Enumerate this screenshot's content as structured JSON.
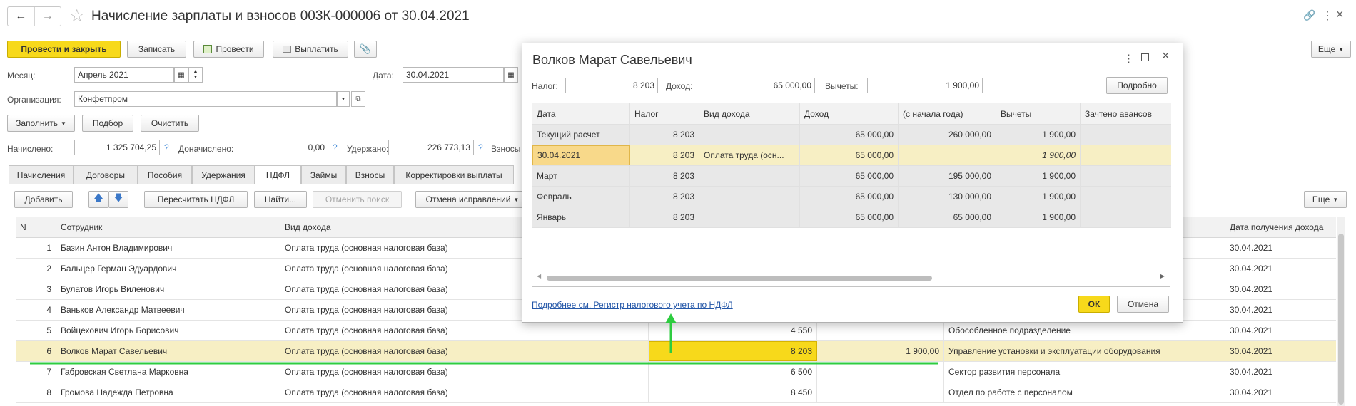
{
  "window": {
    "title": "Начисление зарплаты и взносов 003К-000006 от 30.04.2021"
  },
  "toolbar": {
    "post_close": "Провести и закрыть",
    "save": "Записать",
    "post": "Провести",
    "pay": "Выплатить",
    "more": "Еще"
  },
  "header": {
    "month_label": "Месяц:",
    "month_value": "Апрель 2021",
    "date_label": "Дата:",
    "date_value": "30.04.2021",
    "org_label": "Организация:",
    "org_value": "Конфетпром",
    "fill": "Заполнить",
    "select": "Подбор",
    "clear": "Очистить",
    "accrued_label": "Начислено:",
    "accrued_value": "1 325 704,25",
    "additional_label": "Доначислено:",
    "additional_value": "0,00",
    "withheld_label": "Удержано:",
    "withheld_value": "226 773,13",
    "contrib_label": "Взносы",
    "help": "?"
  },
  "tabs": [
    "Начисления",
    "Договоры",
    "Пособия",
    "Удержания",
    "НДФЛ",
    "Займы",
    "Взносы",
    "Корректировки выплаты"
  ],
  "table_toolbar": {
    "add": "Добавить",
    "recalc": "Пересчитать НДФЛ",
    "find": "Найти...",
    "cancel_search": "Отменить поиск",
    "cancel_fix": "Отмена исправлений",
    "more": "Еще"
  },
  "table": {
    "headers": {
      "n": "N",
      "employee": "Сотрудник",
      "income_type": "Вид дохода",
      "receive_date": "Дата получения дохода"
    },
    "rows": [
      {
        "n": "1",
        "employee": "Базин Антон Владимирович",
        "income": "Оплата труда (основная налоговая база)",
        "tax": "",
        "deduct": "",
        "dept": "",
        "date": "30.04.2021"
      },
      {
        "n": "2",
        "employee": "Бальцер Герман Эдуардович",
        "income": "Оплата труда (основная налоговая база)",
        "tax": "",
        "deduct": "",
        "dept": "",
        "date": "30.04.2021"
      },
      {
        "n": "3",
        "employee": "Булатов Игорь Виленович",
        "income": "Оплата труда (основная налоговая база)",
        "tax": "",
        "deduct": "",
        "dept": "",
        "date": "30.04.2021"
      },
      {
        "n": "4",
        "employee": "Ваньков Александр Матвеевич",
        "income": "Оплата труда (основная налоговая база)",
        "tax": "",
        "deduct": "",
        "dept": "",
        "date": "30.04.2021"
      },
      {
        "n": "5",
        "employee": "Войцехович Игорь Борисович",
        "income": "Оплата труда (основная налоговая база)",
        "tax": "4 550",
        "deduct": "",
        "dept": "Обособленное подразделение",
        "date": "30.04.2021"
      },
      {
        "n": "6",
        "employee": "Волков Марат Савельевич",
        "income": "Оплата труда (основная налоговая база)",
        "tax": "8 203",
        "deduct": "1 900,00",
        "dept": "Управление установки и эксплуатации оборудования",
        "date": "30.04.2021"
      },
      {
        "n": "7",
        "employee": "Габровская Светлана Марковна",
        "income": "Оплата труда (основная налоговая база)",
        "tax": "6 500",
        "deduct": "",
        "dept": "Сектор развития персонала",
        "date": "30.04.2021"
      },
      {
        "n": "8",
        "employee": "Громова Надежда Петровна",
        "income": "Оплата труда (основная налоговая база)",
        "tax": "8 450",
        "deduct": "",
        "dept": "Отдел по работе с персоналом",
        "date": "30.04.2021"
      }
    ]
  },
  "dialog": {
    "title": "Волков Марат Савельевич",
    "tax_label": "Налог:",
    "tax_value": "8 203",
    "income_label": "Доход:",
    "income_value": "65 000,00",
    "deductions_label": "Вычеты:",
    "deductions_value": "1 900,00",
    "details": "Подробно",
    "headers": [
      "Дата",
      "Налог",
      "Вид дохода",
      "Доход",
      "(с начала года)",
      "Вычеты",
      "Зачтено авансов"
    ],
    "rows": [
      [
        "Текущий расчет",
        "8 203",
        "",
        "65 000,00",
        "260 000,00",
        "1 900,00",
        ""
      ],
      [
        "30.04.2021",
        "8 203",
        "Оплата труда (осн...",
        "65 000,00",
        "",
        "1 900,00",
        ""
      ],
      [
        "Март",
        "8 203",
        "",
        "65 000,00",
        "195 000,00",
        "1 900,00",
        ""
      ],
      [
        "Февраль",
        "8 203",
        "",
        "65 000,00",
        "130 000,00",
        "1 900,00",
        ""
      ],
      [
        "Январь",
        "8 203",
        "",
        "65 000,00",
        "65 000,00",
        "1 900,00",
        ""
      ]
    ],
    "link": "Подробнее см. Регистр налогового учета по НДФЛ",
    "ok": "ОК",
    "cancel": "Отмена"
  },
  "colors": {
    "accent_yellow": "#f7d91b",
    "selected_row": "#f7efc4",
    "highlight_green": "#2ecc40",
    "link": "#2457a8"
  }
}
